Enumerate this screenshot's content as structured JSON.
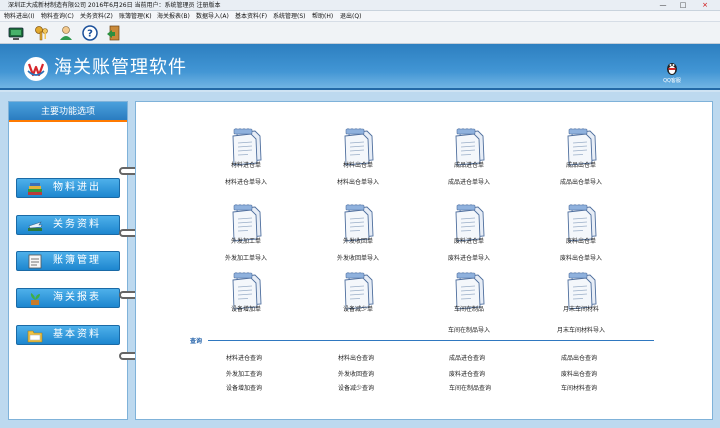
{
  "window": {
    "title": "深圳正大成新材制造有限公司 2016年6月26日 当前用户：系统管理员 注册版本",
    "minimize": "—",
    "maximize": "□",
    "close": "×"
  },
  "menu": [
    "物料进出(I)",
    "物料查询(C)",
    "关务资料(Z)",
    "账簿管理(K)",
    "海关报表(B)",
    "数据导入(A)",
    "基本资料(F)",
    "系统管理(S)",
    "帮助(H)",
    "退出(Q)"
  ],
  "toolbar_icons": [
    "monitor-icon",
    "keys-icon",
    "user-icon",
    "help-icon",
    "exit-door-icon"
  ],
  "banner": {
    "title": "海关账管理软件",
    "qq_label": "QQ客服"
  },
  "left_panel": {
    "header": "主要功能选项",
    "buttons": [
      {
        "label": "物料进出",
        "icon": "books-icon"
      },
      {
        "label": "关务资料",
        "icon": "plane-icon"
      },
      {
        "label": "账簿管理",
        "icon": "ledger-icon"
      },
      {
        "label": "海关报表",
        "icon": "plant-icon"
      },
      {
        "label": "基本资料",
        "icon": "folder-icon"
      }
    ]
  },
  "grid": [
    {
      "label": "材料进仓单",
      "import": "材料进仓单导入"
    },
    {
      "label": "材料出仓单",
      "import": "材料出仓单导入"
    },
    {
      "label": "成品进仓单",
      "import": "成品进仓单导入"
    },
    {
      "label": "成品出仓单",
      "import": "成品出仓单导入"
    },
    {
      "label": "外发加工单",
      "import": "外发加工单导入"
    },
    {
      "label": "外发收回单",
      "import": "外发收回单导入"
    },
    {
      "label": "废料进仓单",
      "import": "废料进仓单导入"
    },
    {
      "label": "废料出仓单",
      "import": "废料出仓单导入"
    },
    {
      "label": "设备增加单",
      "import": ""
    },
    {
      "label": "设备减少单",
      "import": ""
    },
    {
      "label": "车间在制品",
      "import": "车间在制品导入"
    },
    {
      "label": "月末车间材料",
      "import": "月末车间材料导入"
    }
  ],
  "query": {
    "header": "查询",
    "items": [
      "材料进仓查询",
      "材料出仓查询",
      "成品进仓查询",
      "成品出仓查询",
      "外发加工查询",
      "外发收回查询",
      "废料进仓查询",
      "废料出仓查询",
      "设备增加查询",
      "设备减少查询",
      "车间在制品查询",
      "车间材料查询"
    ]
  }
}
